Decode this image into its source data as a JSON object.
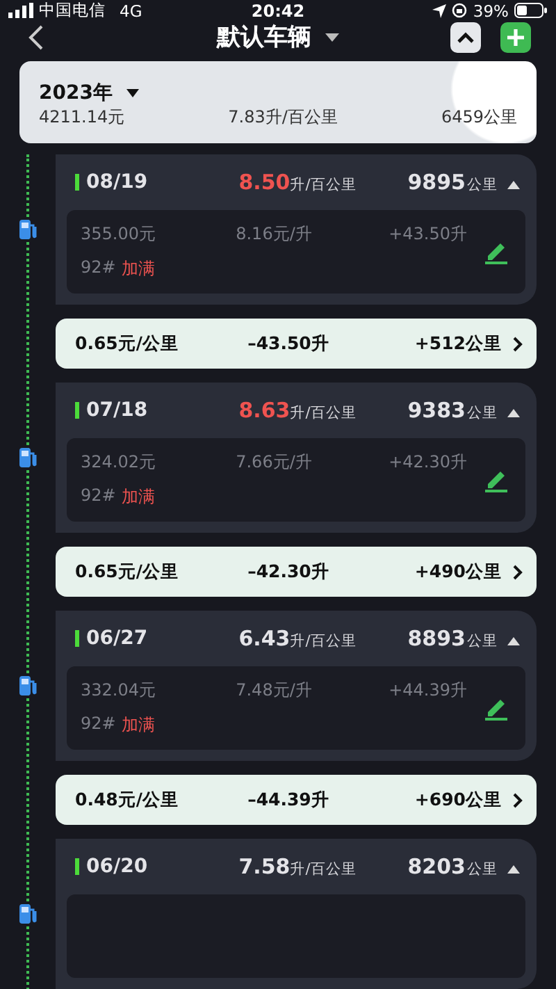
{
  "status_bar": {
    "carrier": "中国电信",
    "network": "4G",
    "time": "20:42",
    "battery": "39%"
  },
  "nav": {
    "title": "默认车辆"
  },
  "summary": {
    "year": "2023年",
    "cost": "4211.14元",
    "consumption": "7.83升/百公里",
    "distance": "6459公里"
  },
  "records": [
    {
      "date": "08/19",
      "consumption": "8.50",
      "consumption_unit": "升/百公里",
      "high": true,
      "odometer": "9895",
      "odometer_unit": "公里",
      "amount": "355.00元",
      "price": "8.16元/升",
      "volume": "+43.50升",
      "fuel": "92#",
      "fill": "加满",
      "expanded": true,
      "interval": {
        "cost_per_km": "0.65元/公里",
        "used": "–43.50升",
        "distance": "+512公里"
      }
    },
    {
      "date": "07/18",
      "consumption": "8.63",
      "consumption_unit": "升/百公里",
      "high": true,
      "odometer": "9383",
      "odometer_unit": "公里",
      "amount": "324.02元",
      "price": "7.66元/升",
      "volume": "+42.30升",
      "fuel": "92#",
      "fill": "加满",
      "expanded": true,
      "interval": {
        "cost_per_km": "0.65元/公里",
        "used": "–42.30升",
        "distance": "+490公里"
      }
    },
    {
      "date": "06/27",
      "consumption": "6.43",
      "consumption_unit": "升/百公里",
      "high": false,
      "odometer": "8893",
      "odometer_unit": "公里",
      "amount": "332.04元",
      "price": "7.48元/升",
      "volume": "+44.39升",
      "fuel": "92#",
      "fill": "加满",
      "expanded": true,
      "interval": {
        "cost_per_km": "0.48元/公里",
        "used": "–44.39升",
        "distance": "+690公里"
      }
    },
    {
      "date": "06/20",
      "consumption": "7.58",
      "consumption_unit": "升/百公里",
      "high": false,
      "odometer": "8203",
      "odometer_unit": "公里",
      "expanded": true
    }
  ]
}
